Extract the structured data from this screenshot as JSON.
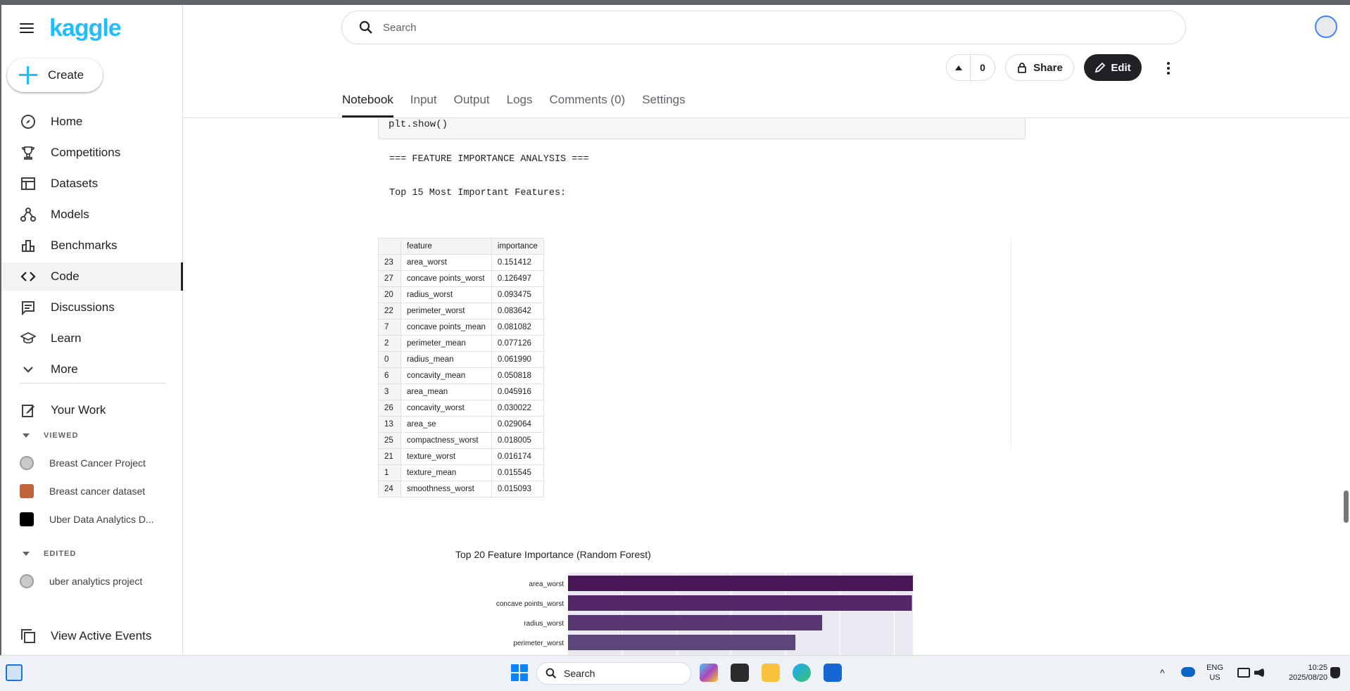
{
  "app": {
    "logo": "kaggle"
  },
  "sidebar": {
    "create_label": "Create",
    "nav": [
      {
        "label": "Home",
        "icon": "compass-icon"
      },
      {
        "label": "Competitions",
        "icon": "trophy-icon"
      },
      {
        "label": "Datasets",
        "icon": "table-icon"
      },
      {
        "label": "Models",
        "icon": "models-icon"
      },
      {
        "label": "Benchmarks",
        "icon": "bar-chart-icon"
      },
      {
        "label": "Code",
        "icon": "code-icon"
      },
      {
        "label": "Discussions",
        "icon": "discussion-icon"
      },
      {
        "label": "Learn",
        "icon": "school-icon"
      },
      {
        "label": "More",
        "icon": "chevron-down-icon"
      }
    ],
    "your_work": "Your Work",
    "viewed_header": "VIEWED",
    "viewed": [
      "Breast Cancer Project",
      "Breast cancer dataset",
      "Uber Data Analytics D..."
    ],
    "edited_header": "EDITED",
    "edited": [
      "uber analytics project"
    ],
    "view_events": "View Active Events"
  },
  "header": {
    "search_placeholder": "Search",
    "vote_count": "0",
    "share_label": "Share",
    "edit_label": "Edit"
  },
  "tabs": [
    "Notebook",
    "Input",
    "Output",
    "Logs",
    "Comments (0)",
    "Settings"
  ],
  "notebook": {
    "code_tail": "plt.show()",
    "output_line1": "=== FEATURE IMPORTANCE ANALYSIS ===",
    "output_line2": "Top 15 Most Important Features:",
    "table": {
      "columns": [
        "",
        "feature",
        "importance"
      ],
      "rows": [
        [
          "23",
          "area_worst",
          "0.151412"
        ],
        [
          "27",
          "concave points_worst",
          "0.126497"
        ],
        [
          "20",
          "radius_worst",
          "0.093475"
        ],
        [
          "22",
          "perimeter_worst",
          "0.083642"
        ],
        [
          "7",
          "concave points_mean",
          "0.081082"
        ],
        [
          "2",
          "perimeter_mean",
          "0.077126"
        ],
        [
          "0",
          "radius_mean",
          "0.061990"
        ],
        [
          "6",
          "concavity_mean",
          "0.050818"
        ],
        [
          "3",
          "area_mean",
          "0.045916"
        ],
        [
          "26",
          "concavity_worst",
          "0.030022"
        ],
        [
          "13",
          "area_se",
          "0.029064"
        ],
        [
          "25",
          "compactness_worst",
          "0.018005"
        ],
        [
          "21",
          "texture_worst",
          "0.016174"
        ],
        [
          "1",
          "texture_mean",
          "0.015545"
        ],
        [
          "24",
          "smoothness_worst",
          "0.015093"
        ]
      ]
    }
  },
  "chart_data": {
    "type": "bar",
    "orientation": "horizontal",
    "title": "Top 20 Feature Importance (Random Forest)",
    "categories": [
      "area_worst",
      "concave points_worst",
      "radius_worst",
      "perimeter_worst"
    ],
    "values": [
      0.151412,
      0.126497,
      0.093475,
      0.083642
    ],
    "colors": [
      "#4a1657",
      "#552768",
      "#5a3672",
      "#5c4579"
    ],
    "background": "#eae8f0",
    "grid": true
  },
  "taskbar": {
    "search_label": "Search",
    "lang_top": "ENG",
    "lang_bottom": "US",
    "time": "10:25",
    "date": "2025/08/20"
  }
}
